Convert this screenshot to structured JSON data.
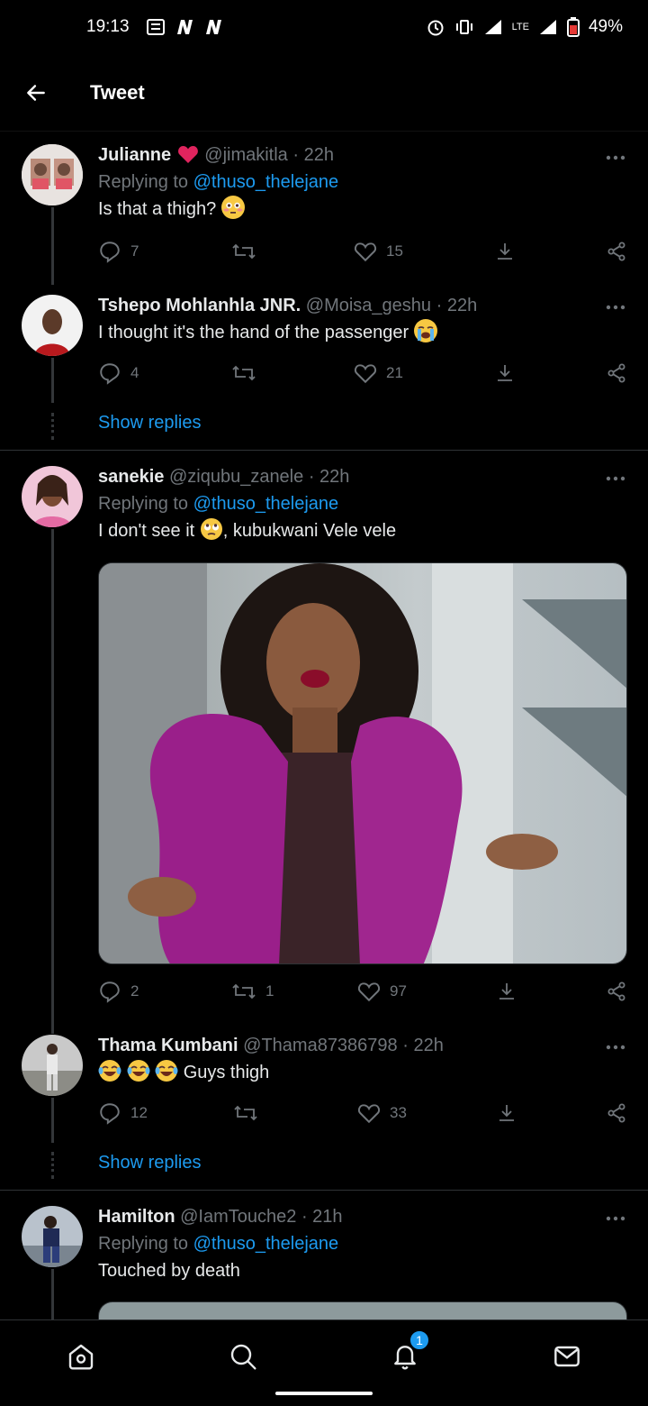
{
  "status_bar": {
    "time": "19:13",
    "battery": "49%",
    "network": "LTE"
  },
  "header": {
    "title": "Tweet"
  },
  "tweets": [
    {
      "name": "Julianne",
      "handle": "@jimakitla",
      "time": "· 22h",
      "replying_prefix": "Replying to ",
      "replying_to": "@thuso_thelejane",
      "text": "Is that a thigh?",
      "replies": "7",
      "retweets": "",
      "likes": "15"
    },
    {
      "name": "Tshepo Mohlanhla JNR.",
      "handle": "@Moisa_geshu",
      "time": "· 22h",
      "text": "I thought it's the hand of the passenger",
      "replies": "4",
      "retweets": "",
      "likes": "21",
      "show_replies": "Show replies"
    },
    {
      "name": "sanekie",
      "handle": "@ziqubu_zanele",
      "time": "· 22h",
      "replying_prefix": "Replying to ",
      "replying_to": "@thuso_thelejane",
      "text_before": "I don't see it ",
      "text_after": ", kubukwani Vele vele",
      "replies": "2",
      "retweets": "1",
      "likes": "97"
    },
    {
      "name": "Thama Kumbani",
      "handle": "@Thama87386798",
      "time": "· 22h",
      "text": "Guys thigh",
      "replies": "12",
      "retweets": "",
      "likes": "33",
      "show_replies": "Show replies"
    },
    {
      "name": "Hamilton",
      "handle": "@IamTouche2",
      "time": "· 21h",
      "replying_prefix": "Replying to ",
      "replying_to": "@thuso_thelejane",
      "text": "Touched by death"
    }
  ],
  "nav": {
    "notifications_badge": "1"
  },
  "colors": {
    "accent": "#1d9bf0",
    "muted": "#71767b",
    "like_red": "#f91880"
  }
}
